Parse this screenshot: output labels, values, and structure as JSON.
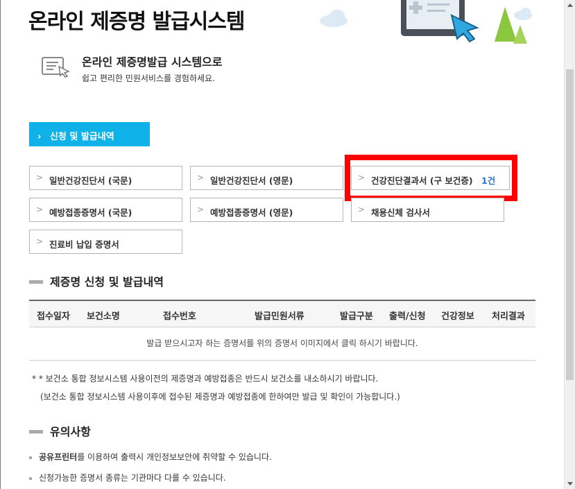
{
  "header": {
    "title": "온라인 제증명 발급시스템"
  },
  "intro": {
    "icon": "document-cursor-icon",
    "title": "온라인 제증명발급 시스템으로",
    "subtitle": "쉽고 편리한 민원서비스를 경험하세요."
  },
  "section_button": {
    "label": "신청 및 발급내역",
    "chevron": "›"
  },
  "certificates": [
    {
      "label": "일반건강진단서 (국문)"
    },
    {
      "label": "일반건강진단서 (영문)"
    },
    {
      "label": "건강진단결과서 (구 보건증)",
      "count": "1건"
    },
    {
      "label": "예방접종증명서 (국문)"
    },
    {
      "label": "예방접종증명서 (영문)"
    },
    {
      "label": "채용신체 검사서"
    },
    {
      "label": "진료비 납입 증명서"
    }
  ],
  "history": {
    "heading": "제증명 신청 및 발급내역",
    "columns": [
      "접수일자",
      "보건소명",
      "접수번호",
      "발급민원서류",
      "발급구분",
      "출력/신청",
      "건강정보",
      "처리결과"
    ],
    "empty_message": "발급 받으시고자 하는 증명서를 위의 증명서 이미지에서 클릭 하시기 바랍니다."
  },
  "notes": {
    "line1": "* * 보건소 통합 정보시스템 사용이전의 제증명과 예방접종은 반드시 보건소를 내소하시기 바랍니다.",
    "line2": "(보건소 통합 정보시스템 사용이후에 접수된 제증명과 예방접종에 한하여만 발급 및 확인이 가능합니다.)"
  },
  "caution": {
    "heading": "유의사항",
    "item1_bold": "공유프린터",
    "item1_rest": "를 이용하여 출력시 개인정보보안에 취약할 수 있습니다.",
    "item2": "신청가능한 증명서 종류는 기관마다 다를 수 있습니다."
  },
  "colors": {
    "accent": "#0fb2e8",
    "highlight": "#ff0000",
    "count": "#2a73c5"
  }
}
